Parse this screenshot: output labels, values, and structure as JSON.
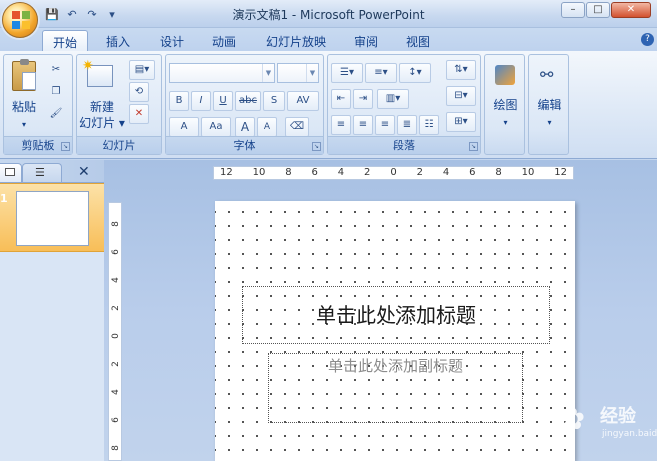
{
  "window": {
    "title": "演示文稿1 - Microsoft PowerPoint",
    "help": "?"
  },
  "qat": {
    "save": "💾",
    "undo": "↶",
    "redo": "↷",
    "customize": "▾"
  },
  "tabs": [
    {
      "label": "开始",
      "active": true
    },
    {
      "label": "插入"
    },
    {
      "label": "设计"
    },
    {
      "label": "动画"
    },
    {
      "label": "幻灯片放映"
    },
    {
      "label": "审阅"
    },
    {
      "label": "视图"
    }
  ],
  "ribbon": {
    "clipboard": {
      "label": "剪贴板",
      "paste": "粘贴"
    },
    "slides": {
      "label": "幻灯片",
      "new_line1": "新建",
      "new_line2": "幻灯片 ▾"
    },
    "font": {
      "label": "字体",
      "bold": "B",
      "italic": "I",
      "underline": "U",
      "strike": "abc",
      "spacing": "AV",
      "fontcolor": "A",
      "case": "Aa",
      "grow": "A",
      "shrink": "A"
    },
    "paragraph": {
      "label": "段落"
    },
    "drawing": {
      "label": "绘图"
    },
    "editing": {
      "label": "编辑"
    }
  },
  "ruler": {
    "horizontal": [
      "12",
      "10",
      "8",
      "6",
      "4",
      "2",
      "0",
      "2",
      "4",
      "6",
      "8",
      "10",
      "12"
    ],
    "vertical": [
      "8",
      "6",
      "4",
      "2",
      "0",
      "2",
      "4",
      "6",
      "8"
    ]
  },
  "slides_panel": {
    "thumb_number": "1"
  },
  "slide": {
    "title_placeholder": "单击此处添加标题",
    "subtitle_placeholder": "单击此处添加副标题"
  },
  "watermark": {
    "text": "经验",
    "url": "jingyan.baidu.com"
  }
}
